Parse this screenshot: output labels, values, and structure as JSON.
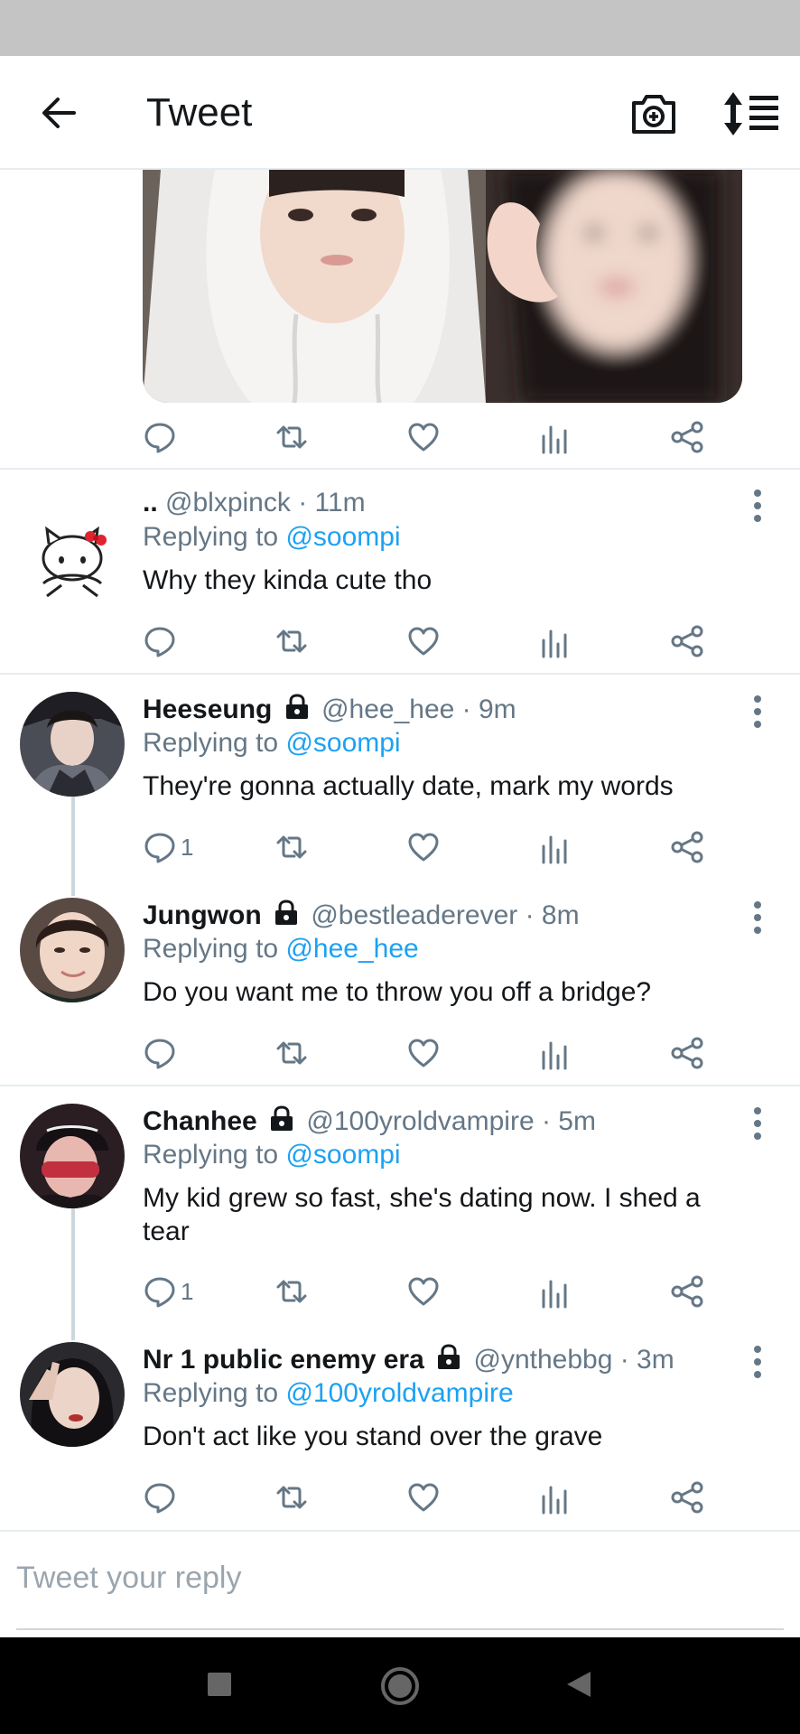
{
  "header": {
    "title": "Tweet",
    "icons": [
      "back-arrow-icon",
      "camera-add-icon",
      "sort-thread-icon"
    ]
  },
  "actions_icons": [
    "reply-icon",
    "retweet-icon",
    "like-icon",
    "analytics-icon",
    "share-icon"
  ],
  "tweets": [
    {
      "name": "..",
      "handle": "@blxpinck",
      "time": "· 11m",
      "replying_label": "Replying to",
      "replying_to": "@soompi",
      "text": "Why they kinda cute tho",
      "reply_count": ""
    },
    {
      "name": "Heeseung",
      "handle": "@hee_hee",
      "time": "· 9m",
      "replying_label": "Replying to",
      "replying_to": "@soompi",
      "text": "They're gonna actually date, mark my words",
      "reply_count": "1"
    },
    {
      "name": "Jungwon",
      "handle": "@bestleaderever",
      "time": "· 8m",
      "replying_label": "Replying to",
      "replying_to": "@hee_hee",
      "text": "Do you want me to throw you off a bridge?",
      "reply_count": ""
    },
    {
      "name": "Chanhee",
      "handle": "@100yroldvampire",
      "time": "· 5m",
      "replying_label": "Replying to",
      "replying_to": "@soompi",
      "text": "My kid grew so fast, she's dating now. I shed a tear",
      "reply_count": "1"
    },
    {
      "name": "Nr 1 public enemy era",
      "handle": "@ynthebbg",
      "time": "· 3m",
      "replying_label": "Replying to",
      "replying_to": "@100yroldvampire",
      "text": "Don't act like you stand over the grave",
      "reply_count": ""
    }
  ],
  "compose": {
    "placeholder": "Tweet your reply"
  },
  "colors": {
    "accent": "#1da1f2",
    "muted": "#657786",
    "divider": "#e6ecf0"
  }
}
